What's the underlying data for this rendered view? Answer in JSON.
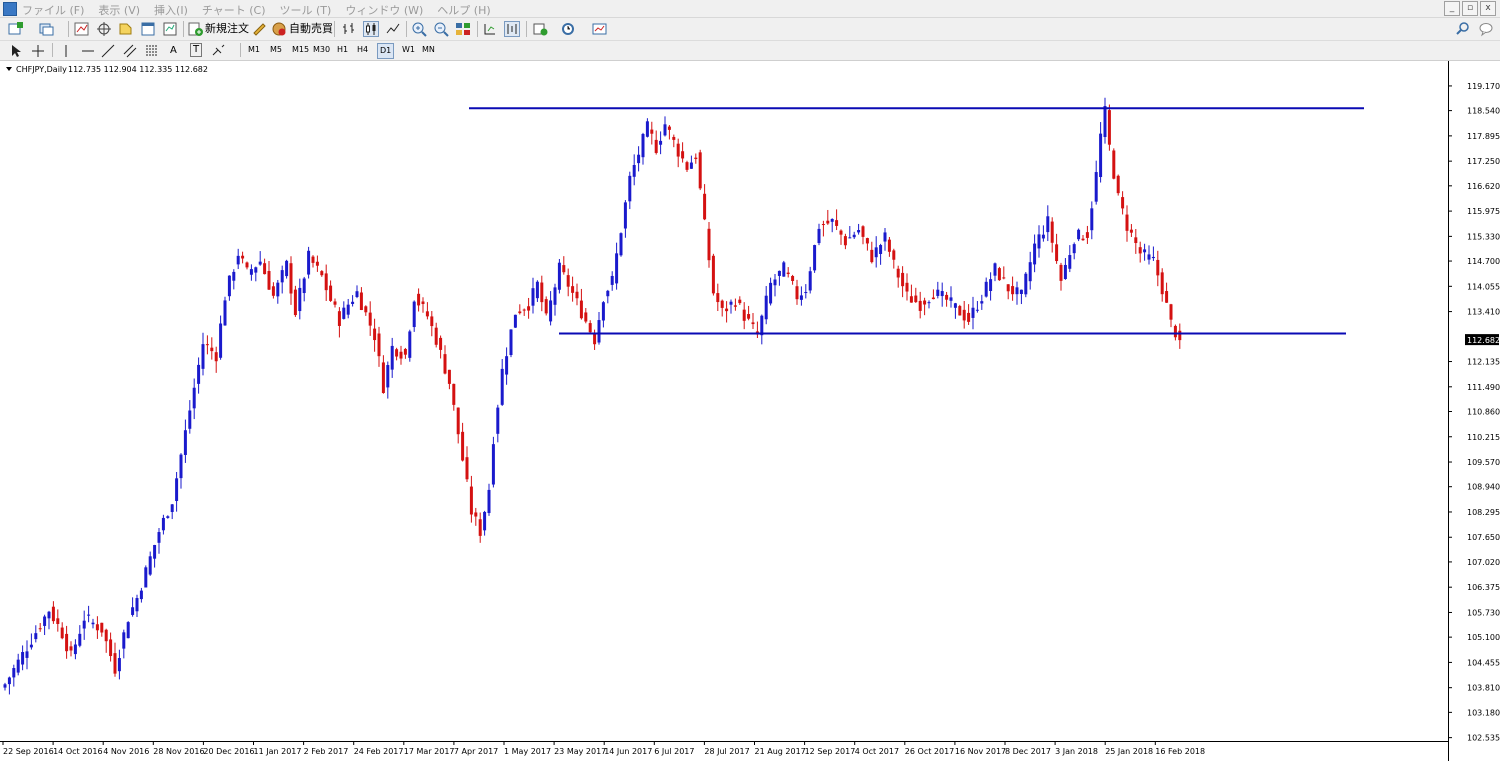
{
  "app": {
    "menu": [
      "ファイル (F)",
      "表示 (V)",
      "挿入(I)",
      "チャート (C)",
      "ツール (T)",
      "ウィンドウ (W)",
      "ヘルプ (H)"
    ],
    "window_buttons": [
      "_",
      "▫",
      "x"
    ],
    "toolbar": {
      "new_order": "新規注文",
      "auto_trade": "自動売買"
    },
    "drawing": {
      "text_tool": "A",
      "label_tool": "T"
    },
    "timeframes": [
      "M1",
      "M5",
      "M15",
      "M30",
      "H1",
      "H4",
      "D1",
      "W1",
      "MN"
    ],
    "active_timeframe": "D1"
  },
  "chart_data": {
    "type": "candlestick",
    "symbol": "CHFJPY,Daily",
    "ohlc_header": "112.735 112.904 112.335 112.682",
    "current_price": "112.682",
    "y_ticks": [
      "119.170",
      "118.540",
      "117.895",
      "117.250",
      "116.620",
      "115.975",
      "115.330",
      "114.700",
      "114.055",
      "113.410",
      "112.135",
      "111.490",
      "110.860",
      "110.215",
      "109.570",
      "108.940",
      "108.295",
      "107.650",
      "107.020",
      "106.375",
      "105.730",
      "105.100",
      "104.455",
      "103.810",
      "103.180",
      "102.535"
    ],
    "ylim": [
      102.5,
      119.5
    ],
    "x_ticks": [
      "22 Sep 2016",
      "14 Oct 2016",
      "4 Nov 2016",
      "28 Nov 2016",
      "20 Dec 2016",
      "11 Jan 2017",
      "2 Feb 2017",
      "24 Feb 2017",
      "17 Mar 2017",
      "7 Apr 2017",
      "1 May 2017",
      "23 May 2017",
      "14 Jun 2017",
      "6 Jul 2017",
      "28 Jul 2017",
      "21 Aug 2017",
      "12 Sep 2017",
      "4 Oct 2017",
      "26 Oct 2017",
      "16 Nov 2017",
      "8 Dec 2017",
      "3 Jan 2018",
      "25 Jan 2018",
      "16 Feb 2018"
    ],
    "price_path": [
      [
        0,
        103.9
      ],
      [
        10,
        105.8
      ],
      [
        13,
        105.2
      ],
      [
        15,
        104.6
      ],
      [
        18,
        105.6
      ],
      [
        22,
        105.3
      ],
      [
        25,
        104.3
      ],
      [
        28,
        105.6
      ],
      [
        30,
        106.1
      ],
      [
        35,
        107.8
      ],
      [
        38,
        108.6
      ],
      [
        42,
        110.9
      ],
      [
        45,
        112.6
      ],
      [
        48,
        112.3
      ],
      [
        50,
        113.8
      ],
      [
        53,
        114.9
      ],
      [
        55,
        114.4
      ],
      [
        58,
        114.7
      ],
      [
        61,
        113.8
      ],
      [
        64,
        114.6
      ],
      [
        66,
        113.4
      ],
      [
        69,
        114.8
      ],
      [
        72,
        114.3
      ],
      [
        74,
        113.7
      ],
      [
        76,
        113.2
      ],
      [
        78,
        113.6
      ],
      [
        80,
        113.9
      ],
      [
        84,
        112.8
      ],
      [
        86,
        111.5
      ],
      [
        88,
        112.5
      ],
      [
        91,
        112.3
      ],
      [
        93,
        113.8
      ],
      [
        96,
        113.3
      ],
      [
        98,
        112.7
      ],
      [
        101,
        111.6
      ],
      [
        103,
        110.3
      ],
      [
        106,
        108.3
      ],
      [
        108,
        107.8
      ],
      [
        110,
        108.9
      ],
      [
        111,
        110.2
      ],
      [
        113,
        111.9
      ],
      [
        116,
        113.4
      ],
      [
        119,
        113.6
      ],
      [
        121,
        114.1
      ],
      [
        123,
        113.2
      ],
      [
        126,
        114.5
      ],
      [
        128,
        114.1
      ],
      [
        131,
        113.4
      ],
      [
        134,
        112.7
      ],
      [
        136,
        113.8
      ],
      [
        138,
        114.2
      ],
      [
        142,
        116.8
      ],
      [
        146,
        118.1
      ],
      [
        148,
        117.6
      ],
      [
        150,
        118.2
      ],
      [
        153,
        117.5
      ],
      [
        155,
        117.1
      ],
      [
        157,
        117.4
      ],
      [
        159,
        115.6
      ],
      [
        161,
        113.9
      ],
      [
        163,
        113.4
      ],
      [
        166,
        113.7
      ],
      [
        168,
        113.3
      ],
      [
        171,
        112.8
      ],
      [
        174,
        114.1
      ],
      [
        177,
        114.5
      ],
      [
        180,
        113.8
      ],
      [
        182,
        114.0
      ],
      [
        185,
        115.6
      ],
      [
        188,
        115.7
      ],
      [
        191,
        115.2
      ],
      [
        194,
        115.5
      ],
      [
        197,
        114.8
      ],
      [
        200,
        115.3
      ],
      [
        202,
        114.6
      ],
      [
        205,
        113.8
      ],
      [
        208,
        113.6
      ],
      [
        211,
        113.9
      ],
      [
        214,
        113.7
      ],
      [
        217,
        113.4
      ],
      [
        219,
        113.2
      ],
      [
        222,
        113.8
      ],
      [
        225,
        114.5
      ],
      [
        228,
        114.0
      ],
      [
        231,
        113.8
      ],
      [
        234,
        115.1
      ],
      [
        237,
        115.7
      ],
      [
        240,
        114.2
      ],
      [
        243,
        115.3
      ],
      [
        246,
        115.4
      ],
      [
        248,
        116.9
      ],
      [
        249,
        117.9
      ],
      [
        250,
        118.5
      ],
      [
        251,
        117.6
      ],
      [
        253,
        116.3
      ],
      [
        255,
        115.6
      ],
      [
        258,
        114.9
      ],
      [
        261,
        114.7
      ],
      [
        263,
        114.0
      ],
      [
        265,
        113.1
      ],
      [
        267,
        112.68
      ]
    ],
    "resistance": 118.6,
    "support": 112.85
  }
}
